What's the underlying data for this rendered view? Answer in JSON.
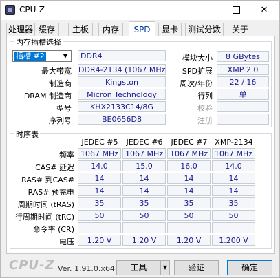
{
  "window": {
    "title": "CPU-Z"
  },
  "tabs": [
    "处理器",
    "缓存",
    "主板",
    "内存",
    "SPD",
    "显卡",
    "测试分数",
    "关于"
  ],
  "active_tab": "SPD",
  "slot_group": {
    "legend": "内存插槽选择",
    "slot_selected": "插槽 #2",
    "type": "DDR4",
    "max_bandwidth_label": "最大带宽",
    "max_bandwidth": "DDR4-2134 (1067 MHz)",
    "manufacturer_label": "制造商",
    "manufacturer": "Kingston",
    "dram_manufacturer_label": "DRAM 制造商",
    "dram_manufacturer": "Micron Technology",
    "model_label": "型号",
    "model": "KHX2133C14/8G",
    "serial_label": "序列号",
    "serial": "BE0656D8",
    "module_size_label": "模块大小",
    "module_size": "8 GBytes",
    "spd_ext_label": "SPD扩展",
    "spd_ext": "XMP 2.0",
    "week_year_label": "周次/年份",
    "week_year": "22 / 16",
    "ranks_label": "行列",
    "ranks": "单",
    "correction_label": "校验",
    "registered_label": "注册"
  },
  "timing_group": {
    "legend": "时序表",
    "columns": [
      "JEDEC #5",
      "JEDEC #6",
      "JEDEC #7",
      "XMP-2134"
    ],
    "rows": [
      {
        "label": "频率",
        "values": [
          "1067 MHz",
          "1067 MHz",
          "1067 MHz",
          "1067 MHz"
        ]
      },
      {
        "label": "CAS# 延迟",
        "values": [
          "14.0",
          "15.0",
          "16.0",
          "14.0"
        ]
      },
      {
        "label": "RAS# 到CAS#",
        "values": [
          "14",
          "14",
          "14",
          "14"
        ]
      },
      {
        "label": "RAS# 预充电",
        "values": [
          "14",
          "14",
          "14",
          "14"
        ]
      },
      {
        "label": "周期时间 (tRAS)",
        "values": [
          "35",
          "35",
          "35",
          "35"
        ]
      },
      {
        "label": "行周期时间 (tRC)",
        "values": [
          "50",
          "50",
          "50",
          "50"
        ]
      },
      {
        "label": "命令率 (CR)",
        "values": [
          "",
          "",
          "",
          ""
        ]
      },
      {
        "label": "电压",
        "values": [
          "1.20 V",
          "1.20 V",
          "1.20 V",
          "1.200 V"
        ]
      }
    ]
  },
  "footer": {
    "logo": "CPU-Z",
    "version": "Ver. 1.91.0.x64",
    "tools_label": "工具",
    "validate_label": "验证",
    "ok_label": "确定"
  }
}
